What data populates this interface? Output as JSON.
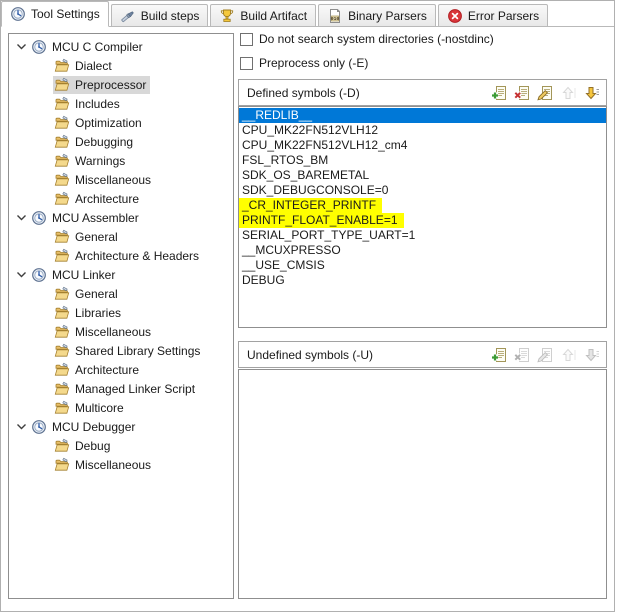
{
  "tabs": [
    {
      "label": "Tool Settings",
      "icon": "gauge-icon",
      "active": true
    },
    {
      "label": "Build steps",
      "icon": "brush-icon",
      "active": false
    },
    {
      "label": "Build Artifact",
      "icon": "trophy-icon",
      "active": false
    },
    {
      "label": "Binary Parsers",
      "icon": "binary-file-icon",
      "active": false
    },
    {
      "label": "Error Parsers",
      "icon": "error-icon",
      "active": false
    }
  ],
  "tree": {
    "sections": [
      {
        "label": "MCU C Compiler",
        "children": [
          "Dialect",
          "Preprocessor",
          "Includes",
          "Optimization",
          "Debugging",
          "Warnings",
          "Miscellaneous",
          "Architecture"
        ]
      },
      {
        "label": "MCU Assembler",
        "children": [
          "General",
          "Architecture & Headers"
        ]
      },
      {
        "label": "MCU Linker",
        "children": [
          "General",
          "Libraries",
          "Miscellaneous",
          "Shared Library Settings",
          "Architecture",
          "Managed Linker Script",
          "Multicore"
        ]
      },
      {
        "label": "MCU Debugger",
        "children": [
          "Debug",
          "Miscellaneous"
        ]
      }
    ],
    "selected": {
      "section": 0,
      "child": 1
    }
  },
  "options": [
    {
      "label": "Do not search system directories (-nostdinc)",
      "checked": false
    },
    {
      "label": "Preprocess only (-E)",
      "checked": false
    }
  ],
  "defined_symbols": {
    "title": "Defined symbols (-D)",
    "items": [
      {
        "text": "__REDLIB__",
        "style": "selected"
      },
      {
        "text": "CPU_MK22FN512VLH12",
        "style": "normal"
      },
      {
        "text": "CPU_MK22FN512VLH12_cm4",
        "style": "normal"
      },
      {
        "text": "FSL_RTOS_BM",
        "style": "normal"
      },
      {
        "text": "SDK_OS_BAREMETAL",
        "style": "normal"
      },
      {
        "text": "SDK_DEBUGCONSOLE=0",
        "style": "normal"
      },
      {
        "text": "_CR_INTEGER_PRINTF",
        "style": "highlighted"
      },
      {
        "text": "PRINTF_FLOAT_ENABLE=1",
        "style": "highlighted"
      },
      {
        "text": "SERIAL_PORT_TYPE_UART=1",
        "style": "normal"
      },
      {
        "text": "__MCUXPRESSO",
        "style": "normal"
      },
      {
        "text": "__USE_CMSIS",
        "style": "normal"
      },
      {
        "text": "DEBUG",
        "style": "normal"
      }
    ],
    "toolbar": [
      {
        "name": "add",
        "enabled": true
      },
      {
        "name": "delete",
        "enabled": true
      },
      {
        "name": "edit",
        "enabled": true
      },
      {
        "name": "move-up",
        "enabled": false
      },
      {
        "name": "move-down",
        "enabled": true
      }
    ]
  },
  "undefined_symbols": {
    "title": "Undefined symbols (-U)",
    "items": [],
    "toolbar": [
      {
        "name": "add",
        "enabled": true
      },
      {
        "name": "delete",
        "enabled": false
      },
      {
        "name": "edit",
        "enabled": false
      },
      {
        "name": "move-up",
        "enabled": false
      },
      {
        "name": "move-down",
        "enabled": false
      }
    ]
  },
  "colors": {
    "selection_blue": "#0078d7",
    "highlight_yellow": "#ffff00",
    "tree_selected_gray": "#d8d8d8"
  }
}
